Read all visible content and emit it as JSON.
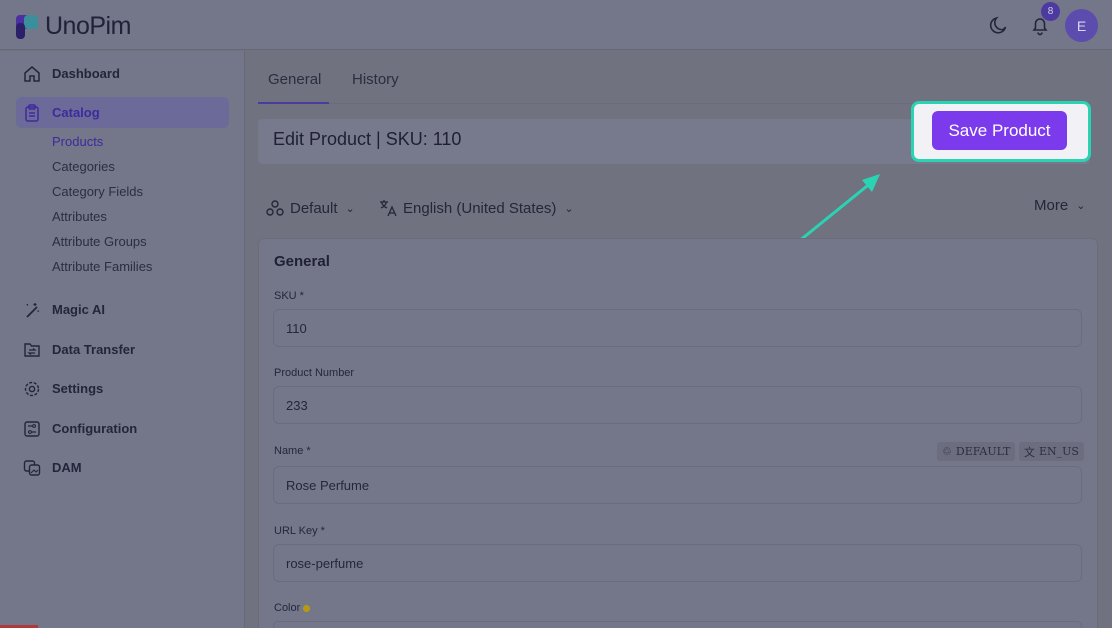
{
  "app": {
    "name": "UnoPim",
    "notification_count": "8",
    "avatar_initial": "E"
  },
  "sidebar": {
    "items": [
      {
        "label": "Dashboard"
      },
      {
        "label": "Catalog"
      },
      {
        "label": "Magic AI"
      },
      {
        "label": "Data Transfer"
      },
      {
        "label": "Settings"
      },
      {
        "label": "Configuration"
      },
      {
        "label": "DAM"
      }
    ],
    "catalog_sub": [
      "Products",
      "Categories",
      "Category Fields",
      "Attributes",
      "Attribute Groups",
      "Attribute Families"
    ]
  },
  "tabs": [
    "General",
    "History"
  ],
  "page": {
    "title": "Edit Product | SKU: 110",
    "save_label": "Save Product"
  },
  "controls": {
    "channel": "Default",
    "locale": "English (United States)",
    "more": "More"
  },
  "form": {
    "section_title": "General",
    "sku": {
      "label": "SKU *",
      "value": "110"
    },
    "product_number": {
      "label": "Product Number",
      "value": "233"
    },
    "name": {
      "label": "Name *",
      "value": "Rose Perfume",
      "tags": [
        "DEFAULT",
        "EN_US"
      ]
    },
    "url_key": {
      "label": "URL Key *",
      "value": "rose-perfume"
    },
    "color": {
      "label": "Color"
    }
  },
  "colors": {
    "accent": "#7c3aed",
    "highlight": "#2ad4b3"
  }
}
